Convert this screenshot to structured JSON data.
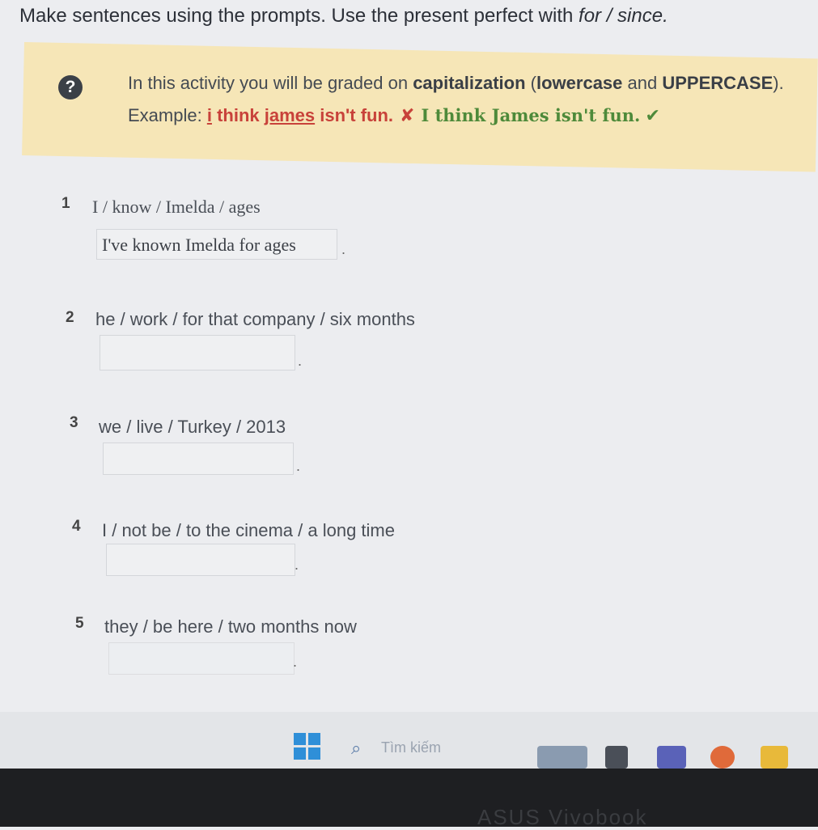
{
  "instruction": {
    "text": "Make sentences using the prompts. Use the present perfect with ",
    "italic": "for / since."
  },
  "info": {
    "line1_a": "In this activity you will be graded on ",
    "line1_b": "capitalization",
    "line1_c": " (",
    "line1_d": "lowercase",
    "line1_e": " and ",
    "line1_f": "UPPERCASE",
    "line1_g": ").",
    "example_label": "Example: ",
    "wrong_i": "i",
    "wrong_think": " think ",
    "wrong_james": "james",
    "wrong_rest": " isn't fun.",
    "x_mark": "✘",
    "right": "I think James isn't fun.",
    "check_mark": "✔"
  },
  "items": [
    {
      "num": "1",
      "prompt": "I / know / Imelda / ages",
      "answer": "I've known Imelda for ages"
    },
    {
      "num": "2",
      "prompt": "he / work / for that company / six months",
      "answer": ""
    },
    {
      "num": "3",
      "prompt": "we / live / Turkey / 2013",
      "answer": ""
    },
    {
      "num": "4",
      "prompt": "I / not be / to the cinema / a long time",
      "answer": ""
    },
    {
      "num": "5",
      "prompt": "they / be here / two months now",
      "answer": ""
    }
  ],
  "period": ".",
  "taskbar": {
    "search_placeholder": "Tìm kiếm"
  },
  "bezel_brand": "ASUS Vivobook"
}
